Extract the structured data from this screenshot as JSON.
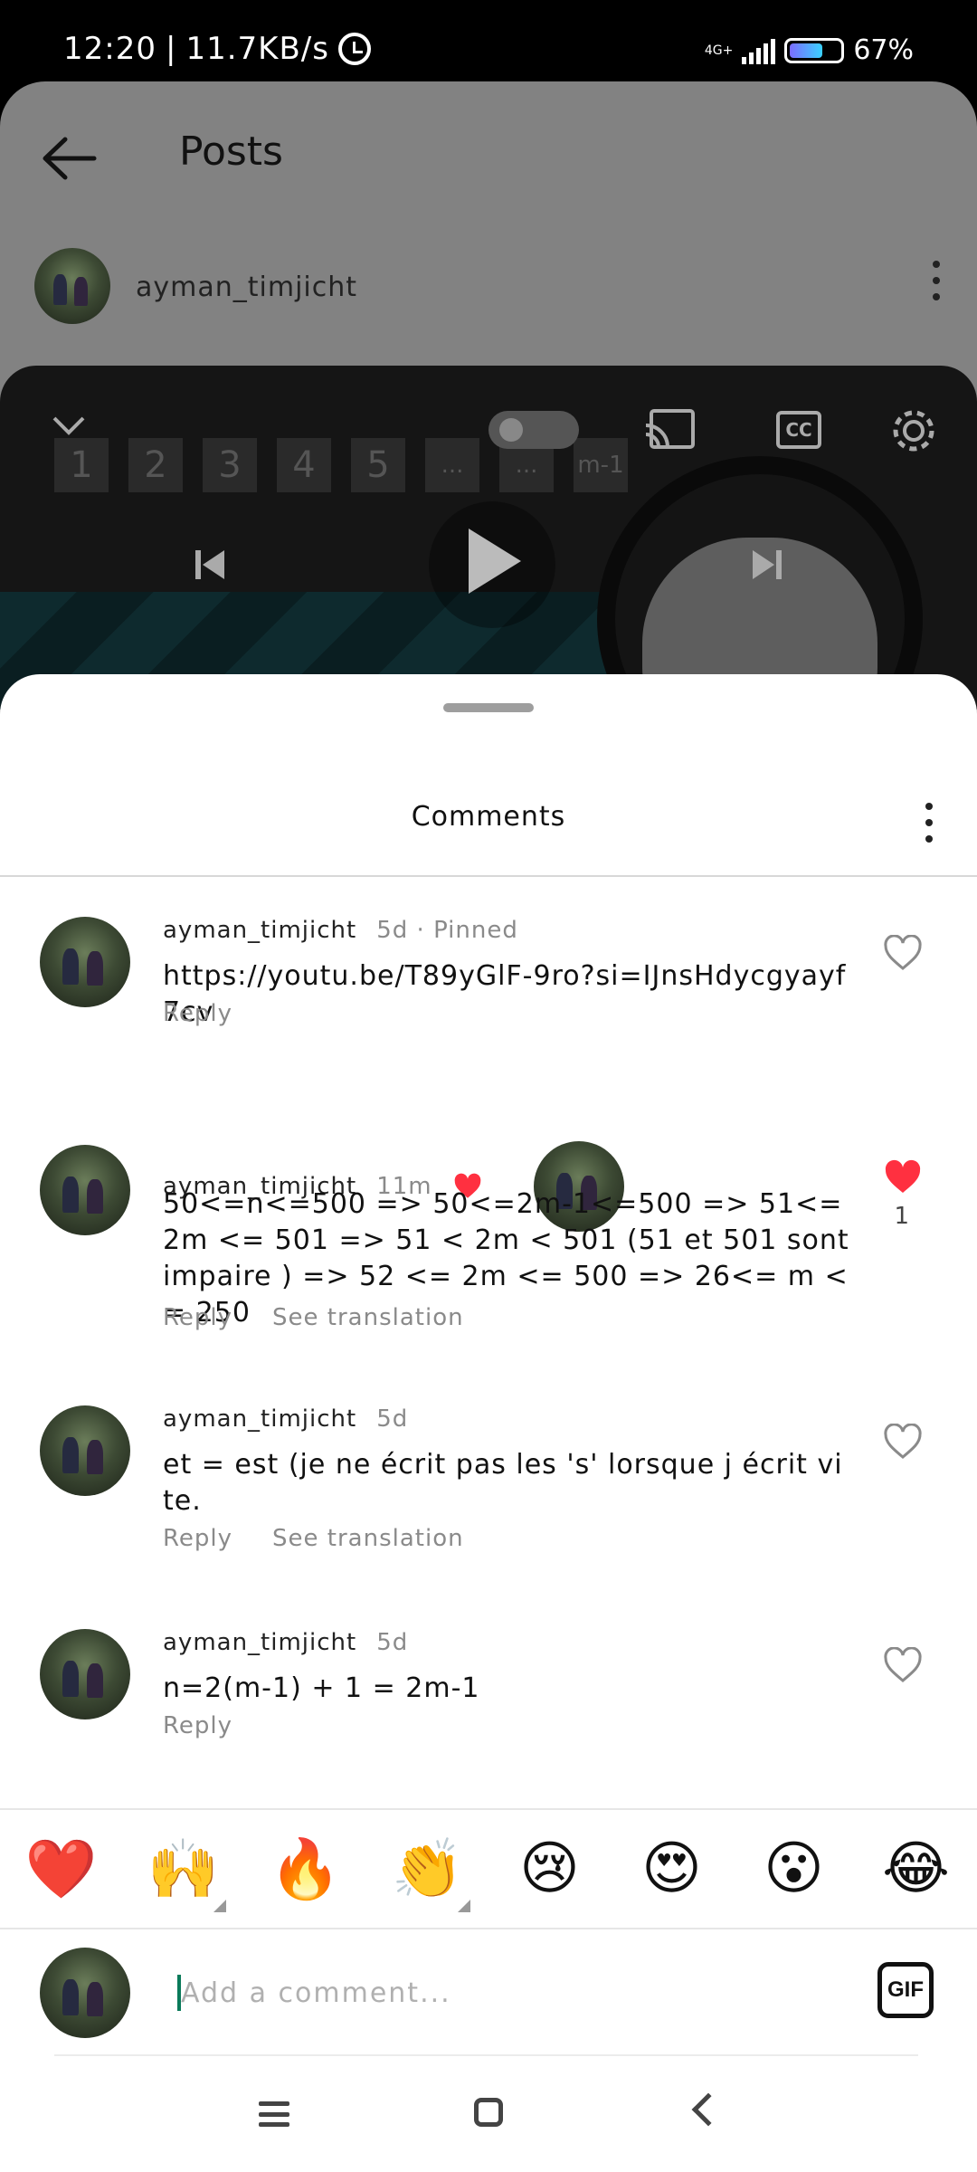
{
  "status_bar": {
    "time": "12:20",
    "speed": "11.7KB/s",
    "network": "4G+",
    "battery": "67%",
    "battery_level": 0.67
  },
  "header": {
    "title": "Posts",
    "author": "ayman_timjicht"
  },
  "video": {
    "boxes": [
      "1",
      "2",
      "3",
      "4",
      "5",
      "...",
      "...",
      "m-1"
    ],
    "cc_label": "CC"
  },
  "comments_sheet": {
    "title": "Comments",
    "comments": [
      {
        "author": "ayman_timjicht",
        "time": "5d",
        "pinned": "Pinned",
        "text": "https://youtu.be/T89yGlF-9ro?si=IJnsHdycgyayf7cv",
        "actions": [
          "Reply"
        ],
        "liked": false
      },
      {
        "author": "ayman_timjicht",
        "time": "11m",
        "text": "50<=n<=500 => 50<=2m-1<=500 => 51<= 2m <= 501 => 51 < 2m < 501 (51 et 501 sont impaire ) => 52 <= 2m <= 500 => 26<= m <= 250",
        "actions": [
          "Reply",
          "See translation"
        ],
        "liked": true,
        "like_count": "1"
      },
      {
        "author": "ayman_timjicht",
        "time": "5d",
        "text": "et = est (je ne écrit pas les 's' lorsque j écrit vite.",
        "actions": [
          "Reply",
          "See translation"
        ],
        "liked": false
      },
      {
        "author": "ayman_timjicht",
        "time": "5d",
        "text": "n=2(m-1) + 1 = 2m-1",
        "actions": [
          "Reply"
        ],
        "liked": false
      }
    ]
  },
  "emoji_bar": [
    "❤️",
    "🙌",
    "🔥",
    "👏",
    "😢",
    "😍",
    "😮",
    "😂"
  ],
  "comment_input": {
    "placeholder": "Add a comment...",
    "gif_label": "GIF"
  },
  "colors": {
    "like_red": "#ff3040",
    "muted_text": "#8a8a8a",
    "overlay_gray": "#828282"
  }
}
